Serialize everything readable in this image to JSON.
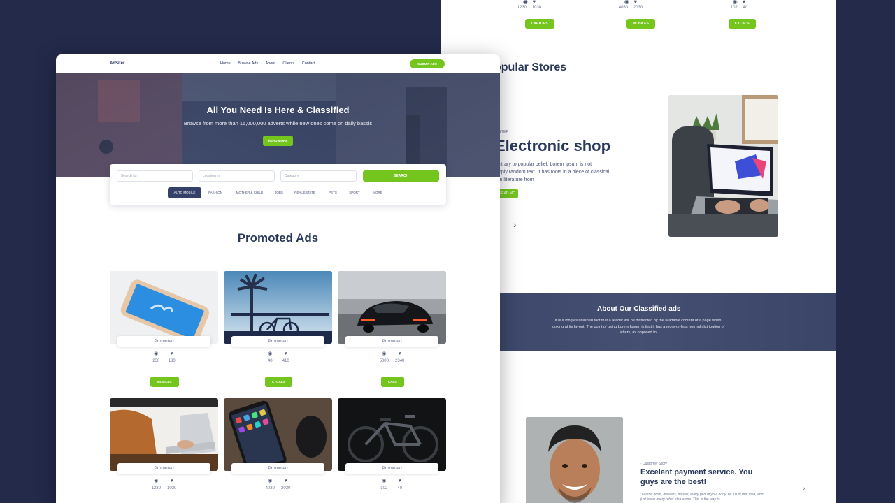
{
  "colors": {
    "accent": "#74c61f",
    "navy": "#2b3a5c",
    "background": "#232a4a"
  },
  "nav": {
    "logo": "AdSiter",
    "links": [
      "Home",
      "Browse Ads",
      "About",
      "Clients",
      "Contact"
    ],
    "submit": "SUBMIT ADS"
  },
  "hero": {
    "title": "All You Need Is Here & Classified",
    "subtitle": "Browse from more than 15,000,000 adverts while new ones come on daily bassis",
    "button": "READ MORE"
  },
  "search": {
    "search_placeholder": "Search for",
    "location_placeholder": "Location in",
    "category_placeholder": "Category",
    "button": "SEARCH",
    "categories": [
      "AUTO MOBILE",
      "FASHION",
      "MOTHER & CHILD",
      "JOBS",
      "REAL ESTATE",
      "PETS",
      "SPORT",
      "MORE"
    ]
  },
  "promoted": {
    "title": "Promoted Ads",
    "label": "Promoted",
    "cards": [
      {
        "views": "230",
        "likes": "130",
        "tag": "MOBILES",
        "image_icon": "phone-photo"
      },
      {
        "views": "40",
        "likes": "410",
        "tag": "CYCALS",
        "image_icon": "bicycle-photo"
      },
      {
        "views": "5000",
        "likes": "2340",
        "tag": "CARS",
        "image_icon": "car-photo"
      },
      {
        "views": "1230",
        "likes": "1030",
        "image_icon": "laptop-photo"
      },
      {
        "views": "4030",
        "likes": "2030",
        "image_icon": "smartphone-photo"
      },
      {
        "views": "102",
        "likes": "40",
        "image_icon": "bike-photo"
      }
    ]
  },
  "back": {
    "stats": [
      {
        "views": "1230",
        "likes": "1030",
        "tag": "LAPTOPS"
      },
      {
        "views": "4030",
        "likes": "2030",
        "tag": "MOBILES"
      },
      {
        "views": "102",
        "likes": "40",
        "tag": "CYCALS"
      }
    ],
    "stores_title": "opular Stores",
    "shop_kicker": "T STEP",
    "shop_title": "Electronic shop",
    "shop_text": "ntrary to popular belief, Lorem Ipsum is not\nnply random text. It has roots in a piece of classical\nin literature from",
    "shop_button": "READ MO",
    "about_title": "About Our Classified ads",
    "about_text": "It is a long established fact that a reader will be distracted by the readable content of a page when looking at its layout. The point of using Lorem Ipsum is that it has a more-or-less normal distribution of letters, as opposed to",
    "story_kicker": "· Customer Story",
    "story_title": "Excelent payment service. You guys are the best!",
    "story_quote": "\"Let the brain, muscles, nerves, every part of your body, be full of that idea, and just leave every other idea alone. This is the way to"
  }
}
